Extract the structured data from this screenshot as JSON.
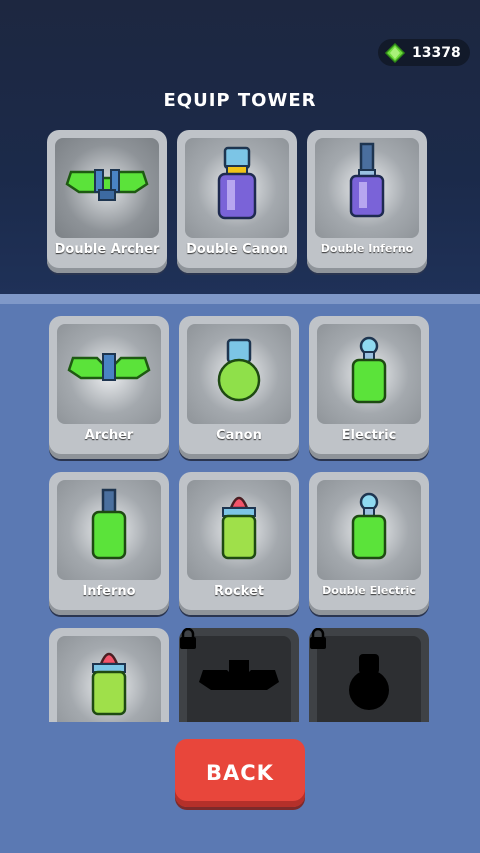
{
  "currency": {
    "amount": "13378",
    "icon": "green-gem-icon"
  },
  "header": {
    "title": "EQUIP TOWER"
  },
  "equipped": [
    {
      "label": "Double Archer",
      "icon": "double-archer-tower-icon"
    },
    {
      "label": "Double Canon",
      "icon": "double-canon-tower-icon"
    },
    {
      "label": "Double Inferno",
      "icon": "double-inferno-tower-icon"
    }
  ],
  "towers": [
    {
      "label": "Archer",
      "icon": "archer-tower-icon",
      "locked": false
    },
    {
      "label": "Canon",
      "icon": "canon-tower-icon",
      "locked": false
    },
    {
      "label": "Electric",
      "icon": "electric-tower-icon",
      "locked": false
    },
    {
      "label": "Inferno",
      "icon": "inferno-tower-icon",
      "locked": false
    },
    {
      "label": "Rocket",
      "icon": "rocket-tower-icon",
      "locked": false
    },
    {
      "label": "Double Electric",
      "icon": "double-electric-tower-icon",
      "locked": false
    },
    {
      "label": "",
      "icon": "rocket-tower-icon",
      "locked": false
    },
    {
      "label": "",
      "icon": "locked-tower-silhouette-icon",
      "locked": true
    },
    {
      "label": "",
      "icon": "locked-tower-silhouette-icon",
      "locked": true
    }
  ],
  "buttons": {
    "back_label": "BACK"
  },
  "colors": {
    "accent_green": "#5be33a",
    "back_red": "#e8463b",
    "panel_blue": "#5b79b3"
  }
}
